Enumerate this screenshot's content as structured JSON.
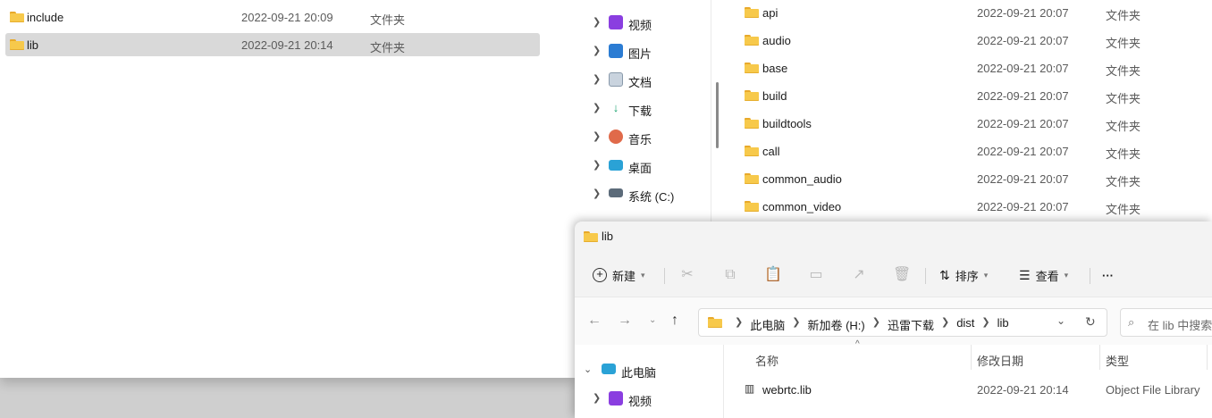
{
  "window1": {
    "rows": [
      {
        "name": "include",
        "date": "2022-09-21 20:09",
        "type": "文件夹",
        "selected": false
      },
      {
        "name": "lib",
        "date": "2022-09-21 20:14",
        "type": "文件夹",
        "selected": true
      }
    ]
  },
  "window2": {
    "nav": [
      {
        "label": "视频",
        "icon": "video-icon"
      },
      {
        "label": "图片",
        "icon": "pictures-icon"
      },
      {
        "label": "文档",
        "icon": "documents-icon"
      },
      {
        "label": "下载",
        "icon": "download-icon"
      },
      {
        "label": "音乐",
        "icon": "music-icon"
      },
      {
        "label": "桌面",
        "icon": "desktop-icon"
      },
      {
        "label": "系统 (C:)",
        "icon": "drive-icon"
      }
    ],
    "rows": [
      {
        "name": "api",
        "date": "2022-09-21 20:07",
        "type": "文件夹"
      },
      {
        "name": "audio",
        "date": "2022-09-21 20:07",
        "type": "文件夹"
      },
      {
        "name": "base",
        "date": "2022-09-21 20:07",
        "type": "文件夹"
      },
      {
        "name": "build",
        "date": "2022-09-21 20:07",
        "type": "文件夹"
      },
      {
        "name": "buildtools",
        "date": "2022-09-21 20:07",
        "type": "文件夹"
      },
      {
        "name": "call",
        "date": "2022-09-21 20:07",
        "type": "文件夹"
      },
      {
        "name": "common_audio",
        "date": "2022-09-21 20:07",
        "type": "文件夹"
      },
      {
        "name": "common_video",
        "date": "2022-09-21 20:07",
        "type": "文件夹"
      }
    ]
  },
  "window3": {
    "title": "lib",
    "toolbar": {
      "new_label": "新建",
      "sort_label": "排序",
      "view_label": "查看",
      "more_label": "···"
    },
    "address": {
      "crumbs": [
        "此电脑",
        "新加卷 (H:)",
        "迅雷下载",
        "dist",
        "lib"
      ],
      "search_placeholder": "在 lib 中搜索"
    },
    "nav": {
      "this_pc": "此电脑",
      "video": "视频"
    },
    "columns": {
      "name": "名称",
      "date": "修改日期",
      "type": "类型"
    },
    "rows": [
      {
        "name": "webrtc.lib",
        "date": "2022-09-21 20:14",
        "type": "Object File Library"
      }
    ]
  },
  "colors": {
    "folder": "#f7c94b",
    "selection": "#d9d9d9",
    "accent": "#0067c0"
  }
}
